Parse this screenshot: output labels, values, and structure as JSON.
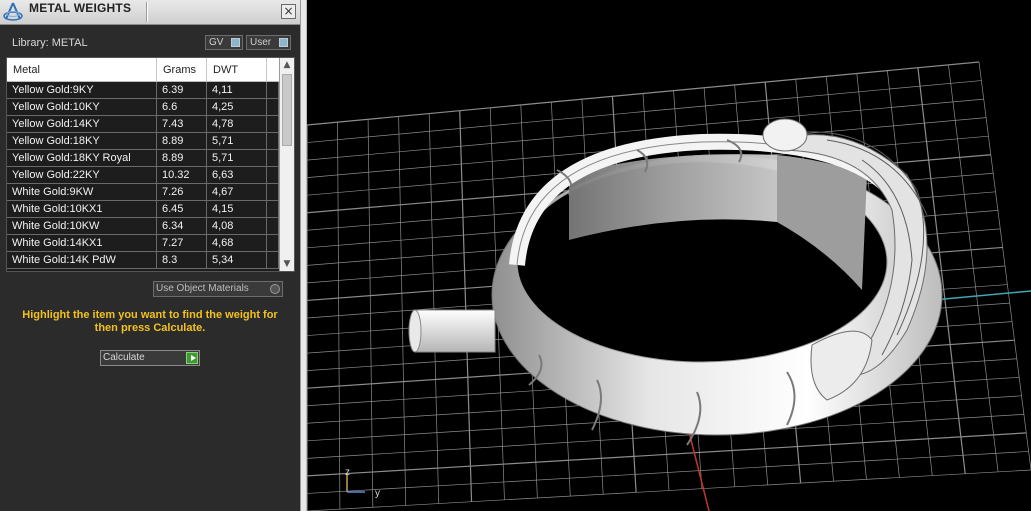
{
  "panel": {
    "title": "METAL WEIGHTS",
    "close_label": "×",
    "library_label": "Library: METAL",
    "gv_label": "GV",
    "user_label": "User",
    "use_materials_label": "Use Object Materials",
    "hint": "Highlight the item you want to find the weight for then press Calculate.",
    "calculate_label": "Calculate"
  },
  "table": {
    "headers": [
      "Metal",
      "Grams",
      "DWT"
    ],
    "rows": [
      {
        "metal": "Yellow Gold:9KY",
        "grams": "6.39",
        "dwt": "4,11"
      },
      {
        "metal": "Yellow Gold:10KY",
        "grams": "6.6",
        "dwt": "4,25"
      },
      {
        "metal": "Yellow Gold:14KY",
        "grams": "7.43",
        "dwt": "4,78"
      },
      {
        "metal": "Yellow Gold:18KY",
        "grams": "8.89",
        "dwt": "5,71"
      },
      {
        "metal": "Yellow Gold:18KY Royal",
        "grams": "8.89",
        "dwt": "5,71"
      },
      {
        "metal": "Yellow Gold:22KY",
        "grams": "10.32",
        "dwt": "6,63"
      },
      {
        "metal": "White Gold:9KW",
        "grams": "7.26",
        "dwt": "4,67"
      },
      {
        "metal": "White Gold:10KX1",
        "grams": "6.45",
        "dwt": "4,15"
      },
      {
        "metal": "White Gold:10KW",
        "grams": "6.34",
        "dwt": "4,08"
      },
      {
        "metal": "White Gold:14KX1",
        "grams": "7.27",
        "dwt": "4,68"
      },
      {
        "metal": "White Gold:14K PdW",
        "grams": "8.3",
        "dwt": "5,34"
      }
    ]
  },
  "viewport": {
    "axis_z": "z",
    "axis_y": "y",
    "colors": {
      "grid": "#8c8c8c",
      "axis_red": "#c0392b",
      "axis_cyan": "#3fa7b3",
      "background": "#000000",
      "hint_text": "#f2c21b"
    }
  }
}
